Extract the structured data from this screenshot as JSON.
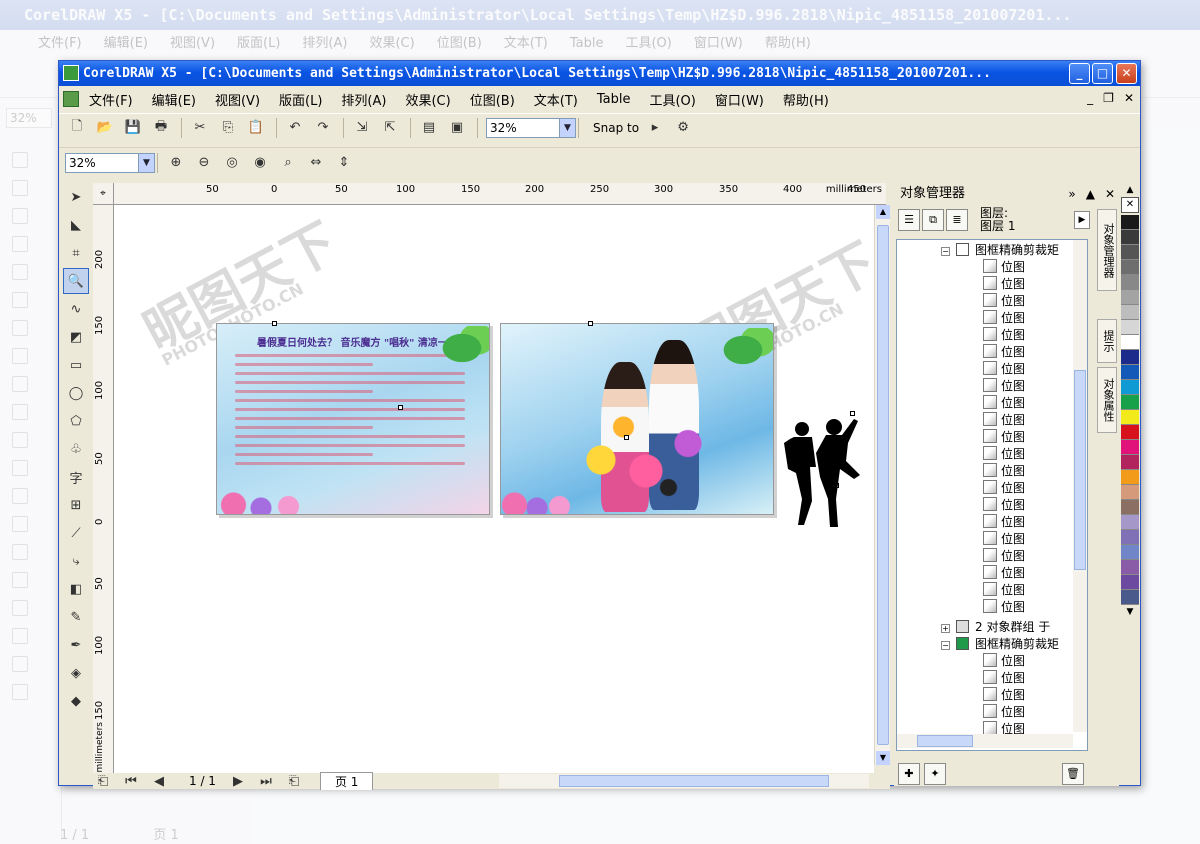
{
  "background_window": {
    "title": "CorelDRAW X5 - [C:\\Documents and Settings\\Administrator\\Local Settings\\Temp\\HZ$D.996.2818\\Nipic_4851158_201007201...",
    "menu": [
      "文件(F)",
      "编辑(E)",
      "视图(V)",
      "版面(L)",
      "排列(A)",
      "效果(C)",
      "位图(B)",
      "文本(T)",
      "Table",
      "工具(O)",
      "窗口(W)",
      "帮助(H)"
    ],
    "zoom": "32%",
    "page_indicator": "1 / 1",
    "page_tab": "页 1"
  },
  "window": {
    "title": "CorelDRAW X5 - [C:\\Documents and Settings\\Administrator\\Local Settings\\Temp\\HZ$D.996.2818\\Nipic_4851158_201007201...",
    "minimize": "_",
    "maximize": "□",
    "close": "✕"
  },
  "menu": {
    "file": "文件(F)",
    "edit": "编辑(E)",
    "view": "视图(V)",
    "layout": "版面(L)",
    "arrange": "排列(A)",
    "effects": "效果(C)",
    "bitmaps": "位图(B)",
    "text": "文本(T)",
    "table": "Table",
    "tools": "工具(O)",
    "window": "窗口(W)",
    "help": "帮助(H)",
    "doc_minimize": "_",
    "doc_restore": "❐",
    "doc_close": "✕"
  },
  "toolbar": {
    "zoom_value": "32%",
    "snap_label": "Snap to",
    "snap_arrow": "▸"
  },
  "property_bar": {
    "zoom_value": "32%"
  },
  "rulers": {
    "horizontal_ticks": [
      "50",
      "0",
      "50",
      "100",
      "150",
      "200",
      "250",
      "300",
      "350",
      "400",
      "450"
    ],
    "unit": "millimeters",
    "vertical_ticks": [
      "200",
      "150",
      "100",
      "50",
      "0",
      "50",
      "100",
      "150"
    ]
  },
  "status": {
    "page_indicator": "1 / 1",
    "page_tab": "页 1"
  },
  "artwork": {
    "card1_headline": "暑假夏日何处去？ 音乐魔方 \"唱秋\" 清凉一 \"夏\"",
    "watermark": "昵图天下",
    "watermark_sub": "PHOTOPHOTO.CN"
  },
  "object_manager": {
    "title": "对象管理器",
    "layer_label": "图层:",
    "layer_name": "图层 1",
    "tree": {
      "group1_label": "图框精确剪裁矩",
      "bitmap_label": "位图",
      "group2_label": "2 对象群组 于",
      "group3_label": "图框精确剪裁矩"
    },
    "side_tabs": [
      "对象管理器",
      "提示",
      "对象属性"
    ]
  },
  "palette_colors": [
    "#1a1a1a",
    "#3a3a3a",
    "#555555",
    "#6e6e6e",
    "#888888",
    "#a3a3a3",
    "#bdbdbd",
    "#d6d6d6",
    "#ffffff",
    "#1c2a8c",
    "#1359b8",
    "#0f9ad4",
    "#19a14a",
    "#f2ea1b",
    "#d8121d",
    "#e1137b",
    "#b1245e",
    "#f29b1a",
    "#d59a7a",
    "#8b6f63",
    "#a597c8",
    "#8070b6",
    "#7086c8",
    "#8a5ca8",
    "#6d4aa0",
    "#4a5a8a"
  ]
}
